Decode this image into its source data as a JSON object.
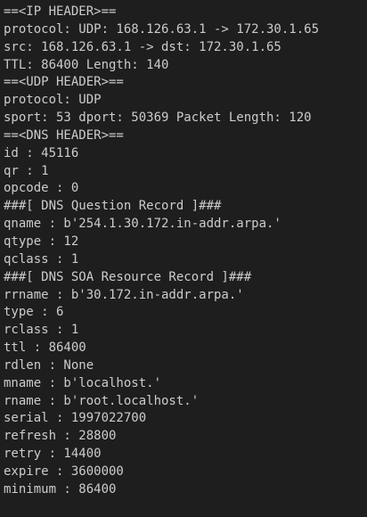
{
  "terminal": {
    "lines": [
      "==<IP HEADER>==",
      "protocol: UDP: 168.126.63.1 -> 172.30.1.65",
      "src: 168.126.63.1 -> dst: 172.30.1.65",
      "TTL: 86400 Length: 140",
      "==<UDP HEADER>==",
      "protocol: UDP",
      "sport: 53 dport: 50369 Packet Length: 120",
      "==<DNS HEADER>==",
      "id : 45116",
      "qr : 1",
      "opcode : 0",
      "###[ DNS Question Record ]###",
      "qname : b'254.1.30.172.in-addr.arpa.'",
      "qtype : 12",
      "qclass : 1",
      "###[ DNS SOA Resource Record ]###",
      "rrname : b'30.172.in-addr.arpa.'",
      "type : 6",
      "rclass : 1",
      "ttl : 86400",
      "rdlen : None",
      "mname : b'localhost.'",
      "rname : b'root.localhost.'",
      "serial : 1997022700",
      "refresh : 28800",
      "retry : 14400",
      "expire : 3600000",
      "minimum : 86400"
    ]
  }
}
